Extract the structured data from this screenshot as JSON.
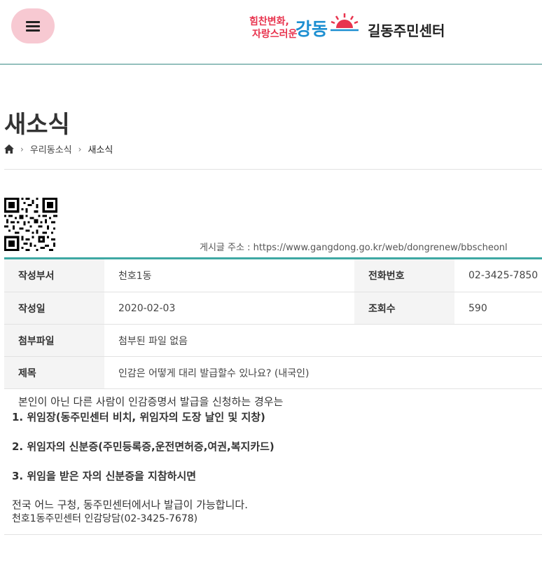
{
  "header": {
    "menu_icon": "hamburger-icon",
    "logo": {
      "slogan_line1": "힘찬변화,",
      "slogan_line2": "자랑스러운",
      "name": "강동",
      "sun_icon": "sun-icon",
      "colors": {
        "slogan": "#e8344e",
        "name": "#1d8fd1",
        "sun": "#e8344e"
      }
    },
    "site_title": "길동주민센터"
  },
  "page": {
    "title": "새소식",
    "breadcrumb": {
      "home_icon": "home-icon",
      "items": [
        "우리동소식",
        "새소식"
      ]
    }
  },
  "post": {
    "qr_icon": "qr-code-icon",
    "url_label": "게시글 주소 : https://www.gangdong.go.kr/web/dongrenew/bbscheonl",
    "fields": {
      "dept_label": "작성부서",
      "dept_value": "천호1동",
      "phone_label": "전화번호",
      "phone_value": "02-3425-7850",
      "date_label": "작성일",
      "date_value": "2020-02-03",
      "views_label": "조회수",
      "views_value": "590",
      "attach_label": "첨부파일",
      "attach_value": "첨부된 파일 없음",
      "subject_label": "제목",
      "subject_value": "인감은 어떻게 대리 발급할수 있나요? (내국인)"
    },
    "body": {
      "intro": "본인이 아닌 다른 사람이 인감증명서 발급을 신청하는 경우는",
      "item1": "1. 위임장(동주민센터 비치, 위임자의 도장 날인 및 지창)",
      "item2": "2. 위임자의 신분증(주민등록증,운전면허증,여권,복지카드)",
      "item3": "3. 위임을 받은 자의 신분증을 지참하시면",
      "note1": "전국 어느 구청, 동주민센터에서나 발급이 가능합니다.",
      "note2": "천호1동주민센터 인감당담(02-3425-7678)"
    },
    "accent_color": "#3ea8a3"
  }
}
